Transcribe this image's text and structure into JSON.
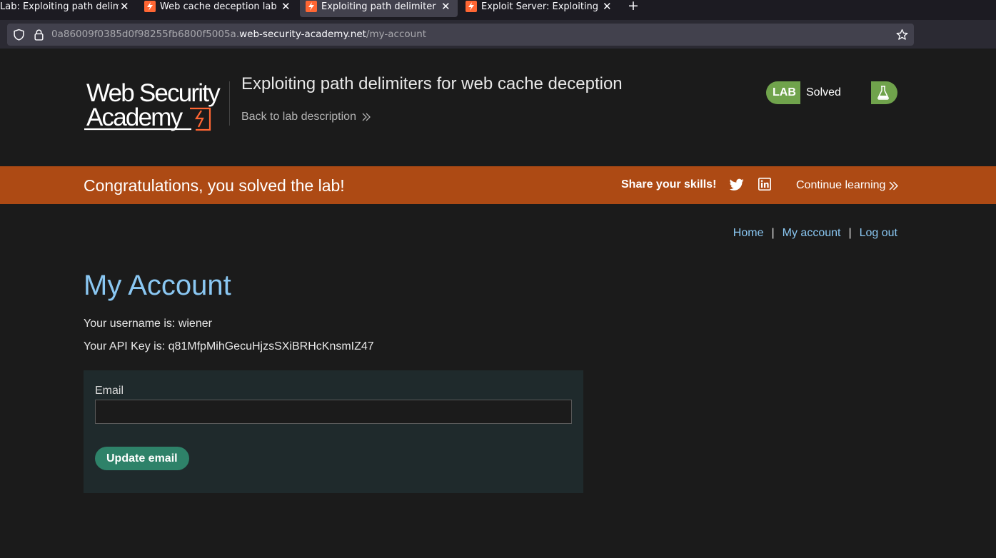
{
  "browser": {
    "tabs": [
      {
        "title": "Lab: Exploiting path delim",
        "active": false,
        "has_icon": false
      },
      {
        "title": "Web cache deception lab",
        "active": false,
        "has_icon": true
      },
      {
        "title": "Exploiting path delimiter",
        "active": true,
        "has_icon": true
      },
      {
        "title": "Exploit Server: Exploiting",
        "active": false,
        "has_icon": true
      }
    ],
    "tab_close_glyph": "✕",
    "new_tab_glyph": "+",
    "url": {
      "prefix": "0a86009f0385d0f98255fb6800f5005a.",
      "host": "web-security-academy.net",
      "path": "/my-account"
    }
  },
  "header": {
    "logo_text_line1": "Web Security",
    "logo_text_line2": "Academy",
    "lab_title": "Exploiting path delimiters for web cache deception",
    "back_link": "Back to lab description",
    "status": {
      "label": "LAB",
      "value": "Solved",
      "color": "#70a34c"
    }
  },
  "banner": {
    "message": "Congratulations, you solved the lab!",
    "share": "Share your skills!",
    "continue": "Continue learning",
    "color": "#ad4a14"
  },
  "nav": {
    "home": "Home",
    "separator": "|",
    "my_account": "My account",
    "logout": "Log out"
  },
  "account": {
    "heading": "My Account",
    "username_line": "Your username is: wiener",
    "api_key_line": "Your API Key is: q81MfpMihGecuHjzsSXiBRHcKnsmIZ47",
    "email_label": "Email",
    "email_value": "",
    "update_button": "Update email"
  },
  "colors": {
    "link": "#8ac7f2",
    "button": "#2e8269",
    "form_bg": "#1f2a2c"
  }
}
